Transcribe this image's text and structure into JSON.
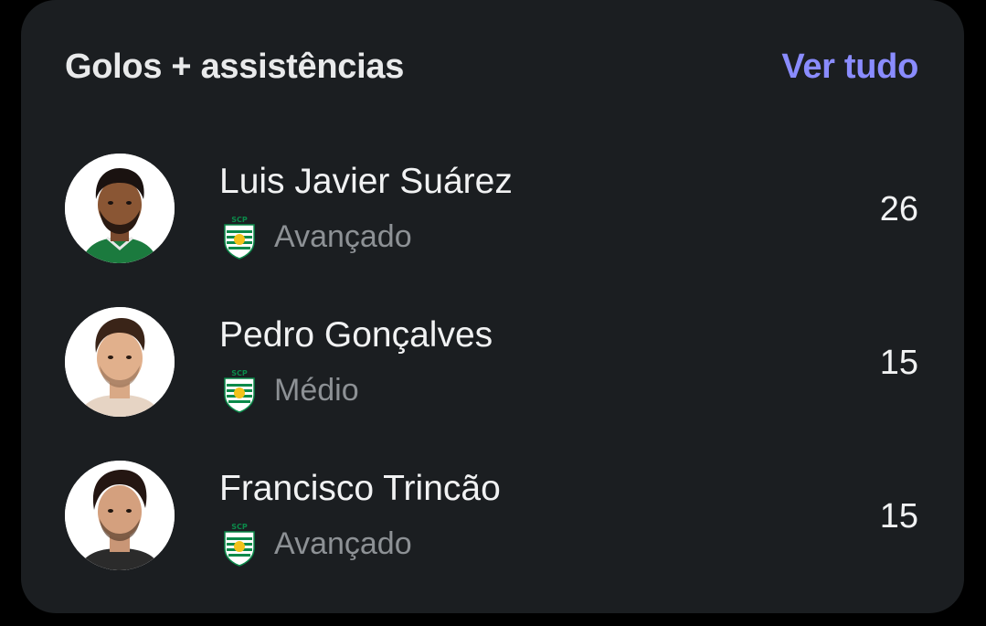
{
  "card": {
    "title": "Golos + assistências",
    "see_all_label": "Ver tudo"
  },
  "players": [
    {
      "name": "Luis Javier Suárez",
      "position": "Avançado",
      "club_icon": "sporting-cp-crest-icon",
      "value": "26"
    },
    {
      "name": "Pedro Gonçalves",
      "position": "Médio",
      "club_icon": "sporting-cp-crest-icon",
      "value": "15"
    },
    {
      "name": "Francisco Trincão",
      "position": "Avançado",
      "club_icon": "sporting-cp-crest-icon",
      "value": "15"
    }
  ],
  "colors": {
    "background": "#000000",
    "card": "#1b1e21",
    "accent": "#8a8cff",
    "text_primary": "#f1f2f3",
    "text_secondary": "#8d9195",
    "club_green": "#0b8a4a"
  }
}
